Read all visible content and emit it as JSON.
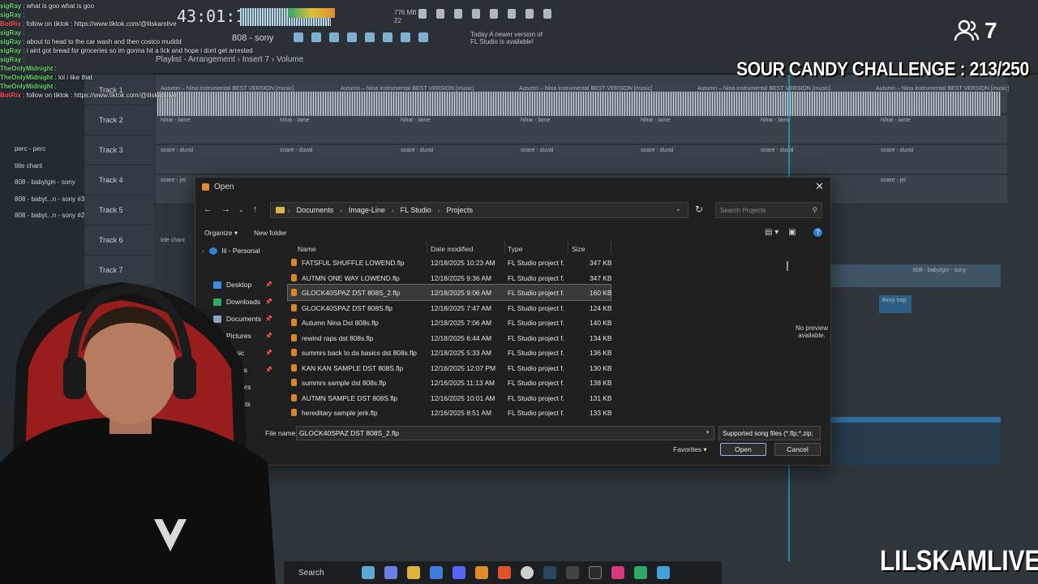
{
  "stream": {
    "viewer_count": "7",
    "challenge": "SOUR CANDY CHALLENGE : 213/250",
    "brand": "LILSKAMLIVE"
  },
  "fl": {
    "time": "43:01:19",
    "memory": [
      "776 MB",
      "22"
    ],
    "pattern": "808 - sony",
    "notice": "Today  A newer version of FL Studio is available!",
    "breadcrumb": "Playlist - Arrangement › Insert 7 › Volume",
    "tracks": [
      "Track 1",
      "Track 2",
      "Track 3",
      "Track 4",
      "Track 5",
      "Track 6",
      "Track 7"
    ],
    "browser_items": [
      "perc - perc",
      "title chant",
      "808 - babytgin - sony",
      "808 - babyt...n - sony #3",
      "808 - babyt...n - sony #2"
    ],
    "clips": {
      "audio": "Autumn – Nina instrumental BEST VERSION [music]",
      "hihat": "hihat - lame",
      "snare_duval": "snare - duval",
      "snare_jet": "snare - jet",
      "title_chant": "title chant",
      "babytgin": "808 - babytgin - sony",
      "benji": "Benji trap"
    }
  },
  "chat": [
    {
      "user": "sigRay",
      "msg": "what is goo what is goo"
    },
    {
      "user": "sigRay",
      "msg": ""
    },
    {
      "user": "BotRix",
      "msg": "follow on tiktok : https://www.tiktok.com/@lilskamlive"
    },
    {
      "user": "sigRay",
      "msg": ""
    },
    {
      "user": "sigRay",
      "msg": "about to head to the car wash and then costco muddd"
    },
    {
      "user": "sigRay",
      "msg": "i aint got bread for groceries so im gonna hit a lick and hope i dont get arrested"
    },
    {
      "user": "sigRay",
      "msg": ""
    },
    {
      "user": "TheOnlyMidnight",
      "msg": ""
    },
    {
      "user": "TheOnlyMidnight",
      "msg": "lol i like that"
    },
    {
      "user": "TheOnlyMidnight",
      "msg": ""
    },
    {
      "user": "BotRix",
      "msg": "follow on tiktok : https://www.tiktok.com/@lilskamlive"
    }
  ],
  "dialog": {
    "title": "Open",
    "close": "✕",
    "path": [
      "Documents",
      "Image-Line",
      "FL Studio",
      "Projects"
    ],
    "search_placeholder": "Search Projects",
    "organize": "Organize ▾",
    "new_folder": "New folder",
    "nav": [
      {
        "label": "lil - Personal",
        "icon": "cloud-icon",
        "color": "#2f7fd6"
      },
      {
        "label": "Desktop",
        "icon": "desktop-icon",
        "color": "#3b8fe0"
      },
      {
        "label": "Downloads",
        "icon": "download-icon",
        "color": "#2fa86a"
      },
      {
        "label": "Documents",
        "icon": "documents-icon",
        "color": "#8aa3c0"
      },
      {
        "label": "Pictures",
        "icon": "pictures-icon",
        "color": "#3b7dd8"
      },
      {
        "label": "Music",
        "icon": "music-icon",
        "color": "#e0524a"
      },
      {
        "label": "Videos",
        "icon": "videos-icon",
        "color": "#8a5bd6"
      },
      {
        "label": "Masters",
        "icon": "folder-icon",
        "color": "#e0b341"
      },
      {
        "label": "enshots",
        "icon": "folder-icon",
        "color": "#e0b341"
      }
    ],
    "columns": {
      "name": "Name",
      "date": "Date modified",
      "type": "Type",
      "size": "Size"
    },
    "files": [
      {
        "name": "FATSFUL SHUFFLE LOWEND.flp",
        "date": "12/18/2025 10:23 AM",
        "type": "FL Studio project f...",
        "size": "347 KB"
      },
      {
        "name": "AUTMN ONE WAY LOWEND.flp",
        "date": "12/18/2025 9:36 AM",
        "type": "FL Studio project f...",
        "size": "347 KB"
      },
      {
        "name": "GLOCK40SPAZ DST 808S_2.flp",
        "date": "12/18/2025 9:06 AM",
        "type": "FL Studio project f...",
        "size": "160 KB"
      },
      {
        "name": "GLOCK40SPAZ DST 808S.flp",
        "date": "12/18/2025 7:47 AM",
        "type": "FL Studio project f...",
        "size": "124 KB"
      },
      {
        "name": "Autumn Nina Dst 808s.flp",
        "date": "12/18/2025 7:06 AM",
        "type": "FL Studio project f...",
        "size": "140 KB"
      },
      {
        "name": "rewind raps dst 808s.flp",
        "date": "12/18/2025 6:44 AM",
        "type": "FL Studio project f...",
        "size": "134 KB"
      },
      {
        "name": "summrs back to da basics dst 808s.flp",
        "date": "12/18/2025 5:33 AM",
        "type": "FL Studio project f...",
        "size": "136 KB"
      },
      {
        "name": "KAN KAN SAMPLE DST 808S.flp",
        "date": "12/16/2025 12:07 PM",
        "type": "FL Studio project f...",
        "size": "130 KB"
      },
      {
        "name": "summrs sample dst 808s.flp",
        "date": "12/16/2025 11:13 AM",
        "type": "FL Studio project f...",
        "size": "138 KB"
      },
      {
        "name": "AUTMN SAMPLE DST 808S.flp",
        "date": "12/16/2025 10:01 AM",
        "type": "FL Studio project f...",
        "size": "131 KB"
      },
      {
        "name": "hereditary sample jerk.flp",
        "date": "12/16/2025 8:51 AM",
        "type": "FL Studio project f...",
        "size": "133 KB"
      }
    ],
    "selected_index": 2,
    "preview": "No preview available.",
    "filename_label": "File name:",
    "filename_value": "GLOCK40SPAZ DST 808S_2.flp",
    "filter": "Supported song files (*.flp;*.zip;",
    "favorites": "Favorites ▾",
    "open": "Open",
    "cancel": "Cancel"
  },
  "taskbar": {
    "search": "Search"
  }
}
